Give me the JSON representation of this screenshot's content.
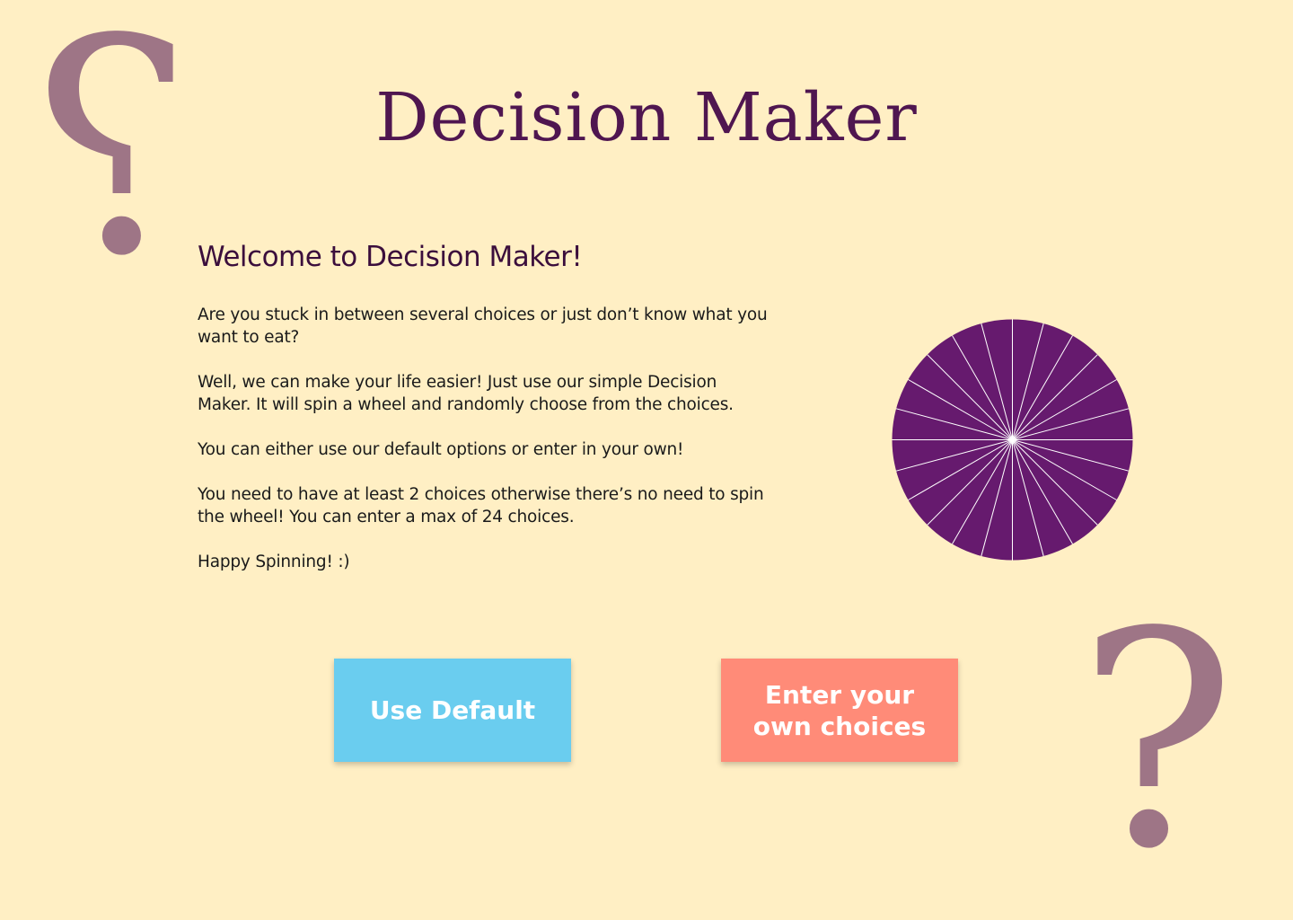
{
  "page": {
    "title": "Decision Maker"
  },
  "intro": {
    "heading": "Welcome to Decision Maker!",
    "paragraphs": [
      "Are you stuck in between several choices or just don’t know what you want to eat?",
      "Well, we can make your life easier! Just use our simple Decision Maker. It will spin a wheel and randomly choose from the choices.",
      "You can either use our default options or enter in your own!",
      "You need to have at least 2 choices otherwise there’s no need to spin the wheel! You can enter a max of 24 choices.",
      "Happy Spinning! :)"
    ]
  },
  "decorations": {
    "question_mark": "?"
  },
  "wheel": {
    "segments": 24,
    "fill_color": "#661A6E",
    "divider_color": "#FFFFFF"
  },
  "buttons": {
    "use_default": "Use Default",
    "own_choices": "Enter your own choices"
  },
  "colors": {
    "background": "#FFEFC4",
    "title": "#4F1650",
    "question_mark": "#9E7586",
    "default_button": "#6ACDEF",
    "own_button": "#FF8B78"
  }
}
